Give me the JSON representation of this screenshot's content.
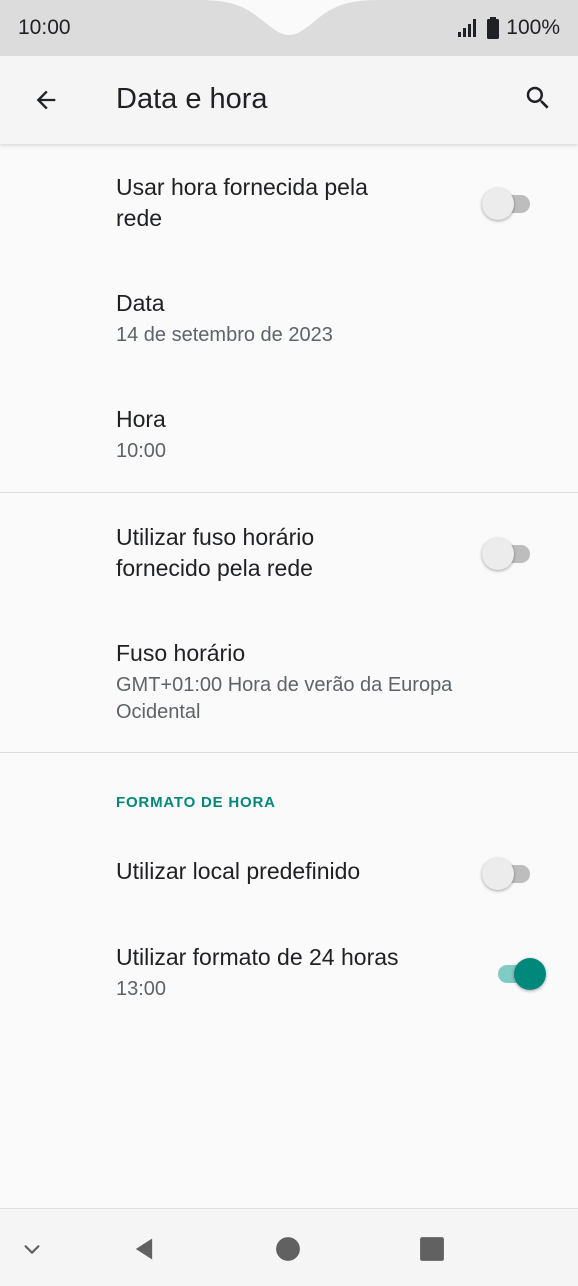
{
  "status_bar": {
    "time": "10:00",
    "battery": "100%"
  },
  "toolbar": {
    "title": "Data e hora"
  },
  "settings": {
    "network_time": {
      "title_line1": "Usar hora fornecida pela",
      "title_line2": "rede",
      "enabled": false
    },
    "date": {
      "title": "Data",
      "value": "14 de setembro de 2023"
    },
    "time": {
      "title": "Hora",
      "value": "10:00"
    },
    "network_timezone": {
      "title_line1": "Utilizar fuso horário",
      "title_line2": "fornecido pela rede",
      "enabled": false
    },
    "timezone": {
      "title": "Fuso horário",
      "value_line1": "GMT+01:00 Hora de verão da Europa",
      "value_line2": "Ocidental"
    }
  },
  "time_format": {
    "header": "FORMATO DE HORA",
    "use_locale_default": {
      "title": "Utilizar local predefinido",
      "enabled": false
    },
    "use_24h": {
      "title": "Utilizar formato de 24 horas",
      "value": "13:00",
      "enabled": true
    }
  },
  "colors": {
    "accent": "#00897b",
    "accent_track": "#80cbc4"
  },
  "icons": {
    "back": "arrow-left-icon",
    "search": "search-icon",
    "signal": "signal-icon",
    "battery": "battery-icon",
    "nav_collapse": "chevron-down-icon",
    "nav_back": "triangle-back-icon",
    "nav_home": "circle-home-icon",
    "nav_recents": "square-recents-icon"
  }
}
